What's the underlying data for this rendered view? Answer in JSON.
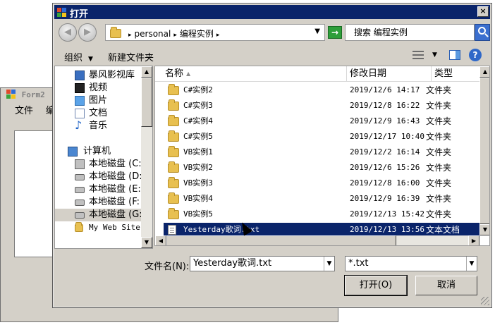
{
  "form2": {
    "title": "Form2",
    "menu": [
      "文件",
      "编"
    ]
  },
  "dialog": {
    "title": "打开",
    "close": "×",
    "nav": {
      "back": "◀",
      "forward": "▶",
      "crumbs": [
        "personal",
        "编程实例"
      ],
      "refresh": "→",
      "search_placeholder": "搜索 编程实例"
    },
    "toolbar": {
      "organize": "组织",
      "new_folder": "新建文件夹",
      "help": "?"
    },
    "navpane": {
      "items": [
        {
          "label": "暴风影视库",
          "icon": "library-icon"
        },
        {
          "label": "视频",
          "icon": "video-icon"
        },
        {
          "label": "图片",
          "icon": "picture-icon"
        },
        {
          "label": "文档",
          "icon": "document-icon"
        },
        {
          "label": "音乐",
          "icon": "music-icon"
        },
        {
          "label": "计算机",
          "icon": "computer-icon"
        },
        {
          "label": "本地磁盘 (C:",
          "icon": "system-disk-icon"
        },
        {
          "label": "本地磁盘 (D:",
          "icon": "disk-icon"
        },
        {
          "label": "本地磁盘 (E:",
          "icon": "disk-icon"
        },
        {
          "label": "本地磁盘 (F:",
          "icon": "disk-icon"
        },
        {
          "label": "本地磁盘 (G:",
          "icon": "disk-icon"
        },
        {
          "label": "My Web Sites",
          "icon": "folder-icon"
        }
      ]
    },
    "columns": {
      "name": "名称",
      "date": "修改日期",
      "type": "类型"
    },
    "files": [
      {
        "name": "C#实例2",
        "date": "2019/12/6 14:17",
        "type": "文件夹",
        "icon": "folder-icon"
      },
      {
        "name": "C#实例3",
        "date": "2019/12/8 16:22",
        "type": "文件夹",
        "icon": "folder-icon"
      },
      {
        "name": "C#实例4",
        "date": "2019/12/9 16:43",
        "type": "文件夹",
        "icon": "folder-icon"
      },
      {
        "name": "C#实例5",
        "date": "2019/12/17 10:40",
        "type": "文件夹",
        "icon": "folder-icon"
      },
      {
        "name": "VB实例1",
        "date": "2019/12/2 16:14",
        "type": "文件夹",
        "icon": "folder-icon"
      },
      {
        "name": "VB实例2",
        "date": "2019/12/6 15:26",
        "type": "文件夹",
        "icon": "folder-icon"
      },
      {
        "name": "VB实例3",
        "date": "2019/12/8 16:00",
        "type": "文件夹",
        "icon": "folder-icon"
      },
      {
        "name": "VB实例4",
        "date": "2019/12/9 16:39",
        "type": "文件夹",
        "icon": "folder-icon"
      },
      {
        "name": "VB实例5",
        "date": "2019/12/13 15:42",
        "type": "文件夹",
        "icon": "folder-icon"
      },
      {
        "name": "Yesterday歌词.txt",
        "date": "2019/12/13 13:56",
        "type": "文本文档",
        "icon": "text-file-icon"
      }
    ],
    "form": {
      "filename_label": "文件名(N):",
      "filename_value": "Yesterday歌词.txt",
      "filter_value": "*.txt",
      "open_button": "打开(O)",
      "cancel_button": "取消"
    },
    "colors": {
      "titlebar": "#0a246a",
      "selection": "#0a246a",
      "face": "#d4d0c8"
    }
  }
}
